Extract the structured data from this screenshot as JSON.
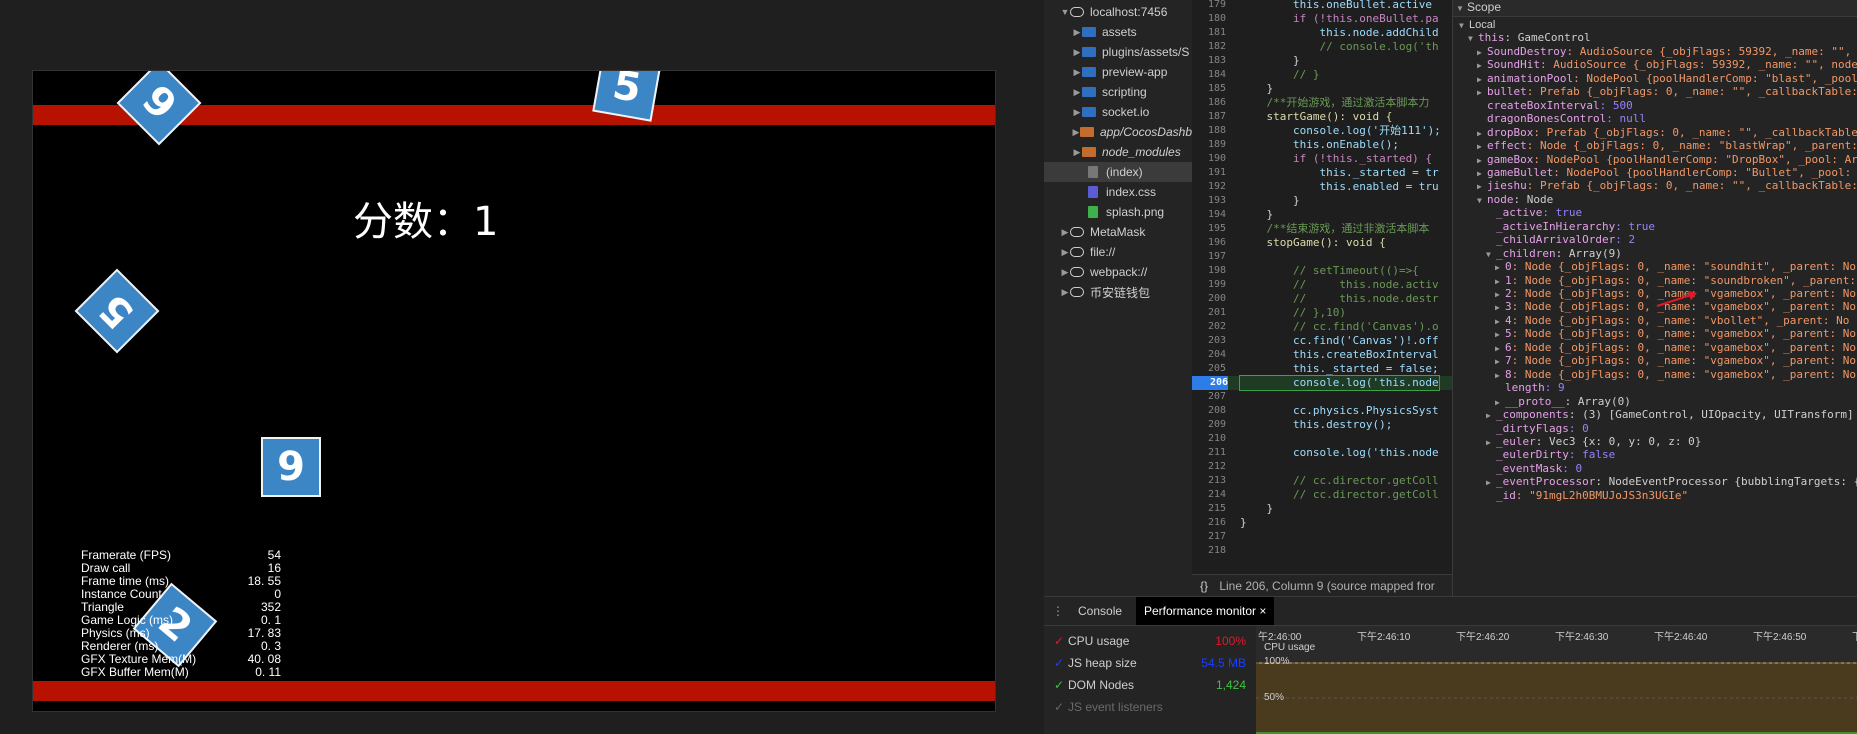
{
  "game": {
    "score_label": "分数：1",
    "boxes": [
      {
        "digit": "9",
        "name": "box-top-left"
      },
      {
        "digit": "5",
        "name": "box-top-center"
      },
      {
        "digit": "5",
        "name": "box-left"
      },
      {
        "digit": "9",
        "name": "box-center"
      },
      {
        "digit": "2",
        "name": "box-bottom"
      }
    ],
    "stats": [
      {
        "label": "Framerate (FPS)",
        "value": "54"
      },
      {
        "label": "Draw call",
        "value": "16"
      },
      {
        "label": "Frame time (ms)",
        "value": "18. 55"
      },
      {
        "label": "Instance Count",
        "value": "0"
      },
      {
        "label": "Triangle",
        "value": "352"
      },
      {
        "label": "Game Logic (ms)",
        "value": "0. 1"
      },
      {
        "label": "Physics (ms)",
        "value": "17. 83"
      },
      {
        "label": "Renderer (ms)",
        "value": "0. 3"
      },
      {
        "label": "GFX Texture Mem(M)",
        "value": "40. 08"
      },
      {
        "label": "GFX Buffer Mem(M)",
        "value": "0. 11"
      }
    ],
    "colors": {
      "bar": "#b71100",
      "box": "#3d86c6"
    }
  },
  "file_tree": [
    {
      "label": "localhost:7456",
      "icon": "cloud-icon",
      "expanded": true
    },
    {
      "label": "assets",
      "icon": "folder-icon"
    },
    {
      "label": "plugins/assets/S",
      "icon": "folder-icon"
    },
    {
      "label": "preview-app",
      "icon": "folder-icon"
    },
    {
      "label": "scripting",
      "icon": "folder-icon"
    },
    {
      "label": "socket.io",
      "icon": "folder-icon"
    },
    {
      "label": "app/CocosDashb",
      "icon": "folder-icon",
      "italic": true
    },
    {
      "label": "node_modules",
      "icon": "folder-icon",
      "italic": true
    },
    {
      "label": "(index)",
      "icon": "file-icon",
      "selected": true
    },
    {
      "label": "index.css",
      "icon": "file-icon"
    },
    {
      "label": "splash.png",
      "icon": "file-icon"
    },
    {
      "label": "MetaMask",
      "icon": "cloud-icon"
    },
    {
      "label": "file://",
      "icon": "cloud-icon"
    },
    {
      "label": "webpack://",
      "icon": "cloud-icon"
    },
    {
      "label": "币安链钱包",
      "icon": "cloud-icon"
    }
  ],
  "code": [
    {
      "n": "179",
      "t": "        this.oneBullet.active"
    },
    {
      "n": "180",
      "t": "        if (!this.oneBullet.pa"
    },
    {
      "n": "181",
      "t": "            this.node.addChild"
    },
    {
      "n": "182",
      "t": "            // console.log('th"
    },
    {
      "n": "183",
      "t": "        }"
    },
    {
      "n": "184",
      "t": "        // }"
    },
    {
      "n": "185",
      "t": "    }"
    },
    {
      "n": "186",
      "t": "    /**开始游戏，通过激活本脚本力"
    },
    {
      "n": "187",
      "t": "    startGame(): void {"
    },
    {
      "n": "188",
      "t": "        console.log('开始111');"
    },
    {
      "n": "189",
      "t": "        this.onEnable();"
    },
    {
      "n": "190",
      "t": "        if (!this._started) {"
    },
    {
      "n": "191",
      "t": "            this._started = tr"
    },
    {
      "n": "192",
      "t": "            this.enabled = tru"
    },
    {
      "n": "193",
      "t": "        }"
    },
    {
      "n": "194",
      "t": "    }"
    },
    {
      "n": "195",
      "t": "    /**结束游戏，通过非激活本脚本"
    },
    {
      "n": "196",
      "t": "    stopGame(): void {"
    },
    {
      "n": "197",
      "t": ""
    },
    {
      "n": "198",
      "t": "        // setTimeout(()=>{"
    },
    {
      "n": "199",
      "t": "        //     this.node.activ"
    },
    {
      "n": "200",
      "t": "        //     this.node.destr"
    },
    {
      "n": "201",
      "t": "        // },10)"
    },
    {
      "n": "202",
      "t": "        // cc.find('Canvas').o"
    },
    {
      "n": "203",
      "t": "        cc.find('Canvas')!.off"
    },
    {
      "n": "204",
      "t": "        this.createBoxInterval"
    },
    {
      "n": "205",
      "t": "        this._started = false;"
    },
    {
      "n": "206",
      "t": "        console.log('this.node",
      "bp": true
    },
    {
      "n": "207",
      "t": ""
    },
    {
      "n": "208",
      "t": "        cc.physics.PhysicsSyst"
    },
    {
      "n": "209",
      "t": "        this.destroy();"
    },
    {
      "n": "210",
      "t": ""
    },
    {
      "n": "211",
      "t": "        console.log('this.node"
    },
    {
      "n": "212",
      "t": ""
    },
    {
      "n": "213",
      "t": "        // cc.director.getColl"
    },
    {
      "n": "214",
      "t": "        // cc.director.getColl"
    },
    {
      "n": "215",
      "t": "    }"
    },
    {
      "n": "216",
      "t": "}"
    },
    {
      "n": "217",
      "t": ""
    },
    {
      "n": "218",
      "t": ""
    }
  ],
  "editor_status": {
    "braces": "{}",
    "text": "Line 206, Column 9  (source mapped fror"
  },
  "scope": {
    "header": "Scope",
    "rows": [
      {
        "indent": 0,
        "tri": "▼",
        "key": "Local",
        "plain": true,
        "val": ""
      },
      {
        "indent": 1,
        "tri": "▼",
        "key": "this",
        "val": ": GameControl"
      },
      {
        "indent": 2,
        "tri": "▶",
        "key": "SoundDestroy",
        "val": ": AudioSource {_objFlags: 59392, _name: \"\", _"
      },
      {
        "indent": 2,
        "tri": "▶",
        "key": "SoundHit",
        "val": ": AudioSource {_objFlags: 59392, _name: \"\", node"
      },
      {
        "indent": 2,
        "tri": "▶",
        "key": "animationPool",
        "val": ": NodePool {poolHandlerComp: \"blast\", _pool"
      },
      {
        "indent": 2,
        "tri": "▶",
        "key": "bullet",
        "val": ": Prefab {_objFlags: 0, _name: \"\", _callbackTable:"
      },
      {
        "indent": 2,
        "tri": "",
        "key": "createBoxInterval",
        "val": ": 500"
      },
      {
        "indent": 2,
        "tri": "",
        "key": "dragonBonesControl",
        "val": ": null"
      },
      {
        "indent": 2,
        "tri": "▶",
        "key": "dropBox",
        "val": ": Prefab {_objFlags: 0, _name: \"\", _callbackTable"
      },
      {
        "indent": 2,
        "tri": "▶",
        "key": "effect",
        "val": ": Node {_objFlags: 0, _name: \"blastWrap\", _parent:"
      },
      {
        "indent": 2,
        "tri": "▶",
        "key": "gameBox",
        "val": ": NodePool {poolHandlerComp: \"DropBox\", _pool: Ar"
      },
      {
        "indent": 2,
        "tri": "▶",
        "key": "gameBullet",
        "val": ": NodePool {poolHandlerComp: \"Bullet\", _pool: A"
      },
      {
        "indent": 2,
        "tri": "▶",
        "key": "jieshu",
        "val": ": Prefab {_objFlags: 0, _name: \"\", _callbackTable:"
      },
      {
        "indent": 2,
        "tri": "▼",
        "key": "node",
        "val": ": Node"
      },
      {
        "indent": 3,
        "tri": "",
        "key": "_active",
        "val": ": true"
      },
      {
        "indent": 3,
        "tri": "",
        "key": "_activeInHierarchy",
        "val": ": true"
      },
      {
        "indent": 3,
        "tri": "",
        "key": "_childArrivalOrder",
        "val": ": 2"
      },
      {
        "indent": 3,
        "tri": "▼",
        "key": "_children",
        "val": ": Array(9)"
      },
      {
        "indent": 4,
        "tri": "▶",
        "key": "0",
        "val": ": Node {_objFlags: 0, _name: \"soundhit\", _parent: No"
      },
      {
        "indent": 4,
        "tri": "▶",
        "key": "1",
        "val": ": Node {_objFlags: 0, _name: \"soundbroken\", _parent:"
      },
      {
        "indent": 4,
        "tri": "▶",
        "key": "2",
        "val": ": Node {_objFlags: 0, _name: \"vgamebox\", _parent: No"
      },
      {
        "indent": 4,
        "tri": "▶",
        "key": "3",
        "val": ": Node {_objFlags: 0, _name: \"vgamebox\", _parent: No"
      },
      {
        "indent": 4,
        "tri": "▶",
        "key": "4",
        "val": ": Node {_objFlags: 0, _name: \"vbollet\", _parent: No"
      },
      {
        "indent": 4,
        "tri": "▶",
        "key": "5",
        "val": ": Node {_objFlags: 0, _name: \"vgamebox\", _parent: No"
      },
      {
        "indent": 4,
        "tri": "▶",
        "key": "6",
        "val": ": Node {_objFlags: 0, _name: \"vgamebox\", _parent: No"
      },
      {
        "indent": 4,
        "tri": "▶",
        "key": "7",
        "val": ": Node {_objFlags: 0, _name: \"vgamebox\", _parent: No"
      },
      {
        "indent": 4,
        "tri": "▶",
        "key": "8",
        "val": ": Node {_objFlags: 0, _name: \"vgamebox\", _parent: No"
      },
      {
        "indent": 4,
        "tri": "",
        "key": "length",
        "val": ": 9"
      },
      {
        "indent": 4,
        "tri": "▶",
        "key": "__proto__",
        "val": ": Array(0)"
      },
      {
        "indent": 3,
        "tri": "▶",
        "key": "_components",
        "val": ": (3) [GameControl, UIOpacity, UITransform]"
      },
      {
        "indent": 3,
        "tri": "",
        "key": "_dirtyFlags",
        "val": ": 0"
      },
      {
        "indent": 3,
        "tri": "▶",
        "key": "_euler",
        "val": ": Vec3 {x: 0, y: 0, z: 0}"
      },
      {
        "indent": 3,
        "tri": "",
        "key": "_eulerDirty",
        "val": ": false"
      },
      {
        "indent": 3,
        "tri": "",
        "key": "_eventMask",
        "val": ": 0"
      },
      {
        "indent": 3,
        "tri": "▶",
        "key": "_eventProcessor",
        "val": ": NodeEventProcessor {bubblingTargets: {"
      },
      {
        "indent": 3,
        "tri": "",
        "key": "_id",
        "val": ": \"91mgL2h0BMUJoJS3n3UGIe\""
      }
    ]
  },
  "drawer": {
    "tabs": [
      {
        "label": "Console"
      },
      {
        "label": "Performance monitor",
        "active": true,
        "close": "×"
      }
    ],
    "metrics": [
      {
        "label": "CPU usage",
        "value": "100%",
        "color": "#e0192b"
      },
      {
        "label": "JS heap size",
        "value": "54.5 MB",
        "color": "#1a3fff"
      },
      {
        "label": "DOM Nodes",
        "value": "1,424",
        "color": "#3fc43f"
      },
      {
        "label": "JS event listeners",
        "value": "",
        "color": "#666666"
      }
    ],
    "chart_ticks": [
      "午2:46:00",
      "下午2:46:10",
      "下午2:46:20",
      "下午2:46:30",
      "下午2:46:40",
      "下午2:46:50",
      "下"
    ],
    "chart_label": "CPU usage",
    "chart_y_labels": [
      "100%",
      "50%"
    ]
  }
}
